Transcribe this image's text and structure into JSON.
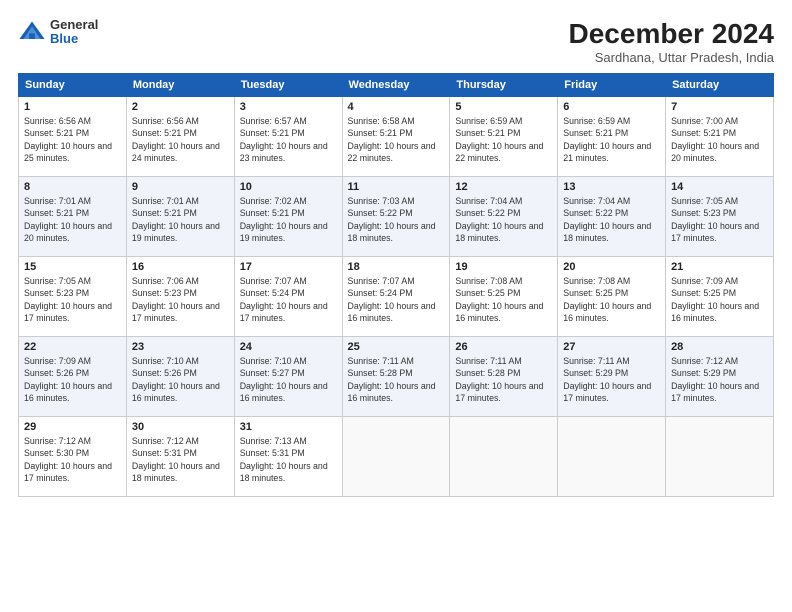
{
  "header": {
    "logo_general": "General",
    "logo_blue": "Blue",
    "month_title": "December 2024",
    "subtitle": "Sardhana, Uttar Pradesh, India"
  },
  "days_of_week": [
    "Sunday",
    "Monday",
    "Tuesday",
    "Wednesday",
    "Thursday",
    "Friday",
    "Saturday"
  ],
  "weeks": [
    [
      {
        "day": "1",
        "sunrise": "6:56 AM",
        "sunset": "5:21 PM",
        "daylight": "10 hours and 25 minutes."
      },
      {
        "day": "2",
        "sunrise": "6:56 AM",
        "sunset": "5:21 PM",
        "daylight": "10 hours and 24 minutes."
      },
      {
        "day": "3",
        "sunrise": "6:57 AM",
        "sunset": "5:21 PM",
        "daylight": "10 hours and 23 minutes."
      },
      {
        "day": "4",
        "sunrise": "6:58 AM",
        "sunset": "5:21 PM",
        "daylight": "10 hours and 22 minutes."
      },
      {
        "day": "5",
        "sunrise": "6:59 AM",
        "sunset": "5:21 PM",
        "daylight": "10 hours and 22 minutes."
      },
      {
        "day": "6",
        "sunrise": "6:59 AM",
        "sunset": "5:21 PM",
        "daylight": "10 hours and 21 minutes."
      },
      {
        "day": "7",
        "sunrise": "7:00 AM",
        "sunset": "5:21 PM",
        "daylight": "10 hours and 20 minutes."
      }
    ],
    [
      {
        "day": "8",
        "sunrise": "7:01 AM",
        "sunset": "5:21 PM",
        "daylight": "10 hours and 20 minutes."
      },
      {
        "day": "9",
        "sunrise": "7:01 AM",
        "sunset": "5:21 PM",
        "daylight": "10 hours and 19 minutes."
      },
      {
        "day": "10",
        "sunrise": "7:02 AM",
        "sunset": "5:21 PM",
        "daylight": "10 hours and 19 minutes."
      },
      {
        "day": "11",
        "sunrise": "7:03 AM",
        "sunset": "5:22 PM",
        "daylight": "10 hours and 18 minutes."
      },
      {
        "day": "12",
        "sunrise": "7:04 AM",
        "sunset": "5:22 PM",
        "daylight": "10 hours and 18 minutes."
      },
      {
        "day": "13",
        "sunrise": "7:04 AM",
        "sunset": "5:22 PM",
        "daylight": "10 hours and 18 minutes."
      },
      {
        "day": "14",
        "sunrise": "7:05 AM",
        "sunset": "5:23 PM",
        "daylight": "10 hours and 17 minutes."
      }
    ],
    [
      {
        "day": "15",
        "sunrise": "7:05 AM",
        "sunset": "5:23 PM",
        "daylight": "10 hours and 17 minutes."
      },
      {
        "day": "16",
        "sunrise": "7:06 AM",
        "sunset": "5:23 PM",
        "daylight": "10 hours and 17 minutes."
      },
      {
        "day": "17",
        "sunrise": "7:07 AM",
        "sunset": "5:24 PM",
        "daylight": "10 hours and 17 minutes."
      },
      {
        "day": "18",
        "sunrise": "7:07 AM",
        "sunset": "5:24 PM",
        "daylight": "10 hours and 16 minutes."
      },
      {
        "day": "19",
        "sunrise": "7:08 AM",
        "sunset": "5:25 PM",
        "daylight": "10 hours and 16 minutes."
      },
      {
        "day": "20",
        "sunrise": "7:08 AM",
        "sunset": "5:25 PM",
        "daylight": "10 hours and 16 minutes."
      },
      {
        "day": "21",
        "sunrise": "7:09 AM",
        "sunset": "5:25 PM",
        "daylight": "10 hours and 16 minutes."
      }
    ],
    [
      {
        "day": "22",
        "sunrise": "7:09 AM",
        "sunset": "5:26 PM",
        "daylight": "10 hours and 16 minutes."
      },
      {
        "day": "23",
        "sunrise": "7:10 AM",
        "sunset": "5:26 PM",
        "daylight": "10 hours and 16 minutes."
      },
      {
        "day": "24",
        "sunrise": "7:10 AM",
        "sunset": "5:27 PM",
        "daylight": "10 hours and 16 minutes."
      },
      {
        "day": "25",
        "sunrise": "7:11 AM",
        "sunset": "5:28 PM",
        "daylight": "10 hours and 16 minutes."
      },
      {
        "day": "26",
        "sunrise": "7:11 AM",
        "sunset": "5:28 PM",
        "daylight": "10 hours and 17 minutes."
      },
      {
        "day": "27",
        "sunrise": "7:11 AM",
        "sunset": "5:29 PM",
        "daylight": "10 hours and 17 minutes."
      },
      {
        "day": "28",
        "sunrise": "7:12 AM",
        "sunset": "5:29 PM",
        "daylight": "10 hours and 17 minutes."
      }
    ],
    [
      {
        "day": "29",
        "sunrise": "7:12 AM",
        "sunset": "5:30 PM",
        "daylight": "10 hours and 17 minutes."
      },
      {
        "day": "30",
        "sunrise": "7:12 AM",
        "sunset": "5:31 PM",
        "daylight": "10 hours and 18 minutes."
      },
      {
        "day": "31",
        "sunrise": "7:13 AM",
        "sunset": "5:31 PM",
        "daylight": "10 hours and 18 minutes."
      },
      null,
      null,
      null,
      null
    ]
  ]
}
